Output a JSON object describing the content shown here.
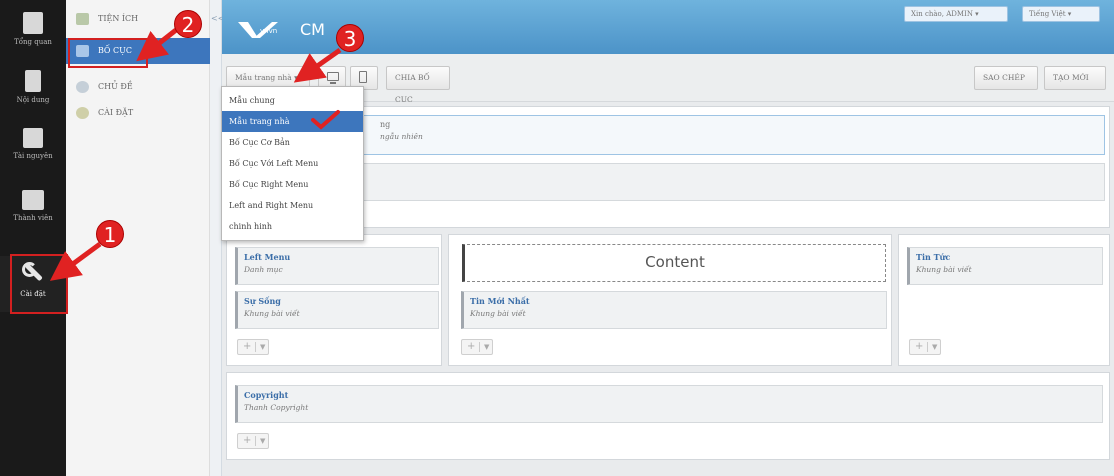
{
  "rail": {
    "items": [
      {
        "label": "Tổng quan",
        "icon": "home-icon"
      },
      {
        "label": "Nội dung",
        "icon": "document-icon"
      },
      {
        "label": "Tài nguyên",
        "icon": "archive-icon"
      },
      {
        "label": "Thành viên",
        "icon": "users-icon"
      },
      {
        "label": "Cài đặt",
        "icon": "wrench-icon"
      }
    ]
  },
  "subnav": {
    "items": [
      {
        "label": "Tiện ích"
      },
      {
        "label": "Bố cục"
      },
      {
        "label": "Chủ đề"
      },
      {
        "label": "Cài đặt"
      }
    ]
  },
  "collapse": {
    "label": "<<"
  },
  "header": {
    "logo_text": "vnvn",
    "logo_suffix": "CM",
    "greeting": "Xin chào, ADMIN ▾",
    "language": "Tiếng Việt ▾"
  },
  "toolbar": {
    "template_select": "Mẫu trang nhà ▾",
    "split_layout": "Chia bố cục",
    "copy": "Sao chép",
    "create_new": "Tạo mới"
  },
  "dropdown": {
    "options": [
      "Mẫu chung",
      "Mẫu trang nhà",
      "Bố Cục Cơ Bản",
      "Bố Cục Với Left Menu",
      "Bố Cục Right Menu",
      "Left and Right Menu",
      "chinh hinh"
    ],
    "selected_index": 1
  },
  "canvas": {
    "top_block_title": "ng",
    "top_block_sub": "ngẫu nhiên",
    "left_col": [
      {
        "title": "Left Menu",
        "sub": "Danh mục"
      },
      {
        "title": "Sự Sống",
        "sub": "Khung bài viết"
      }
    ],
    "center_content": "Content",
    "center_col": [
      {
        "title": "Tin Mới Nhất",
        "sub": "Khung bài viết"
      }
    ],
    "right_col": [
      {
        "title": "Tin Tức",
        "sub": "Khung bài viết"
      }
    ],
    "footer_block": {
      "title": "Copyright",
      "sub": "Thanh Copyright"
    }
  },
  "annotations": {
    "badges": [
      "1",
      "2",
      "3"
    ],
    "color": "#e02222"
  },
  "colors": {
    "accent": "#3d76bd",
    "header": "#5aa2d3",
    "rail": "#1a1a1a"
  }
}
